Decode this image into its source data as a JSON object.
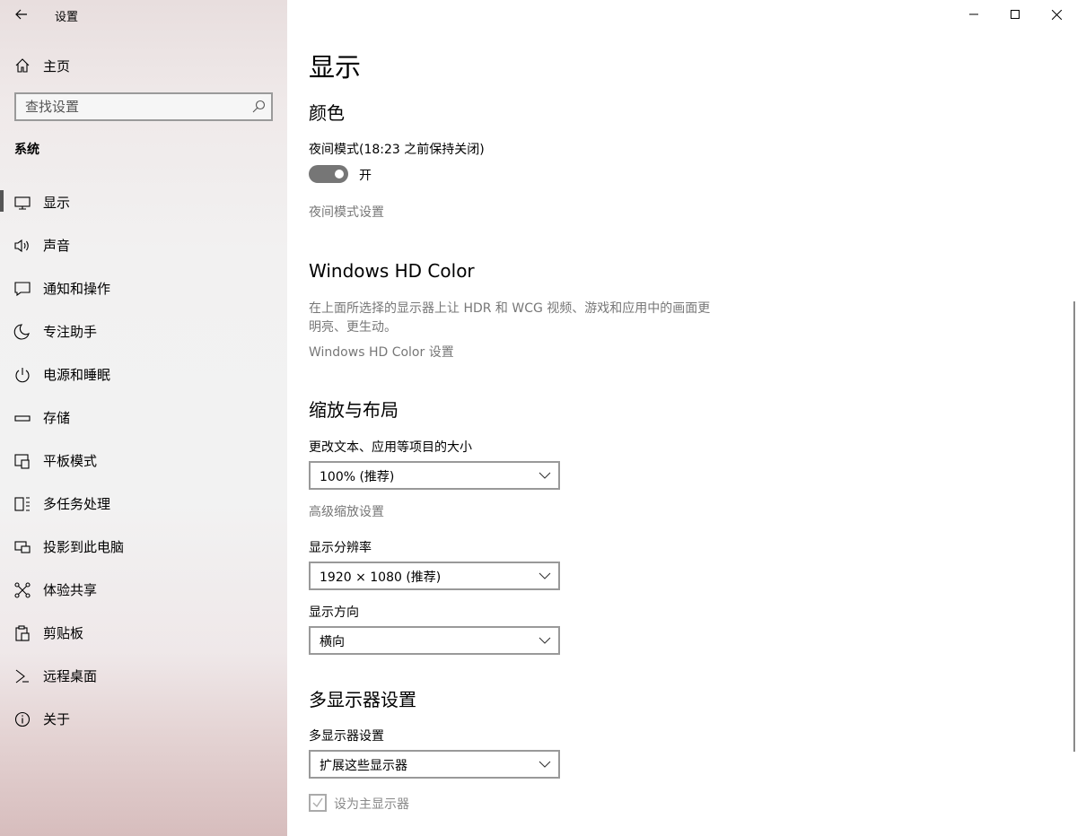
{
  "window": {
    "title": "设置"
  },
  "sidebar": {
    "home_label": "主页",
    "search_placeholder": "查找设置",
    "section_label": "系统",
    "items": [
      {
        "label": "显示",
        "icon": "monitor-icon",
        "active": true
      },
      {
        "label": "声音",
        "icon": "speaker-icon"
      },
      {
        "label": "通知和操作",
        "icon": "notification-icon"
      },
      {
        "label": "专注助手",
        "icon": "moon-icon"
      },
      {
        "label": "电源和睡眠",
        "icon": "power-icon"
      },
      {
        "label": "存储",
        "icon": "storage-icon"
      },
      {
        "label": "平板模式",
        "icon": "tablet-icon"
      },
      {
        "label": "多任务处理",
        "icon": "multitask-icon"
      },
      {
        "label": "投影到此电脑",
        "icon": "project-icon"
      },
      {
        "label": "体验共享",
        "icon": "share-icon"
      },
      {
        "label": "剪贴板",
        "icon": "clipboard-icon"
      },
      {
        "label": "远程桌面",
        "icon": "remote-desktop-icon"
      },
      {
        "label": "关于",
        "icon": "info-icon"
      }
    ]
  },
  "main": {
    "page_title": "显示",
    "color": {
      "heading": "颜色",
      "night_light_label": "夜间模式(18:23 之前保持关闭)",
      "toggle_state": "开",
      "night_light_settings_link": "夜间模式设置"
    },
    "hdr": {
      "heading": "Windows HD Color",
      "description": "在上面所选择的显示器上让 HDR 和 WCG 视频、游戏和应用中的画面更明亮、更生动。",
      "settings_link": "Windows HD Color 设置"
    },
    "scale": {
      "heading": "缩放与布局",
      "size_label": "更改文本、应用等项目的大小",
      "size_value": "100% (推荐)",
      "advanced_link": "高级缩放设置",
      "resolution_label": "显示分辨率",
      "resolution_value": "1920 × 1080 (推荐)",
      "orientation_label": "显示方向",
      "orientation_value": "横向"
    },
    "multi": {
      "heading": "多显示器设置",
      "label": "多显示器设置",
      "value": "扩展这些显示器",
      "primary_checkbox_label": "设为主显示器"
    }
  },
  "colors": {
    "toggle_on": "#767676",
    "link_gray": "#777777"
  }
}
